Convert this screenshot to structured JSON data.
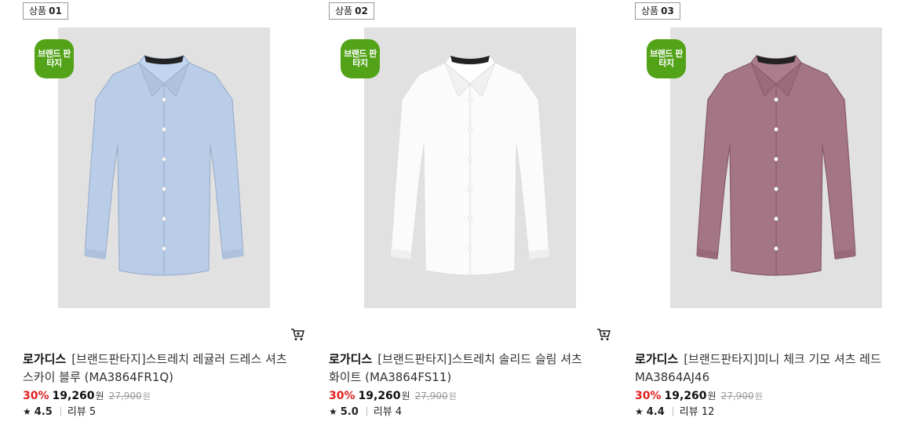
{
  "products": [
    {
      "tag_prefix": "상품",
      "tag_number": "01",
      "badge": "브랜드 판타지",
      "brand": "로가디스",
      "name": "[브랜드판타지]스트레치 레귤러 드레스 셔츠 스카이 블루 (MA3864FR1Q)",
      "discount": "30%",
      "price": "19,260",
      "currency": "원",
      "original_price": "27,900",
      "original_currency": "원",
      "star_icon": "star-icon",
      "rating": "4.5",
      "review_label": "리뷰 5",
      "shirt_color": "#b9cde9",
      "image_icon": "dress-shirt-image",
      "cart_icon": "cart-icon"
    },
    {
      "tag_prefix": "상품",
      "tag_number": "02",
      "badge": "브랜드 판타지",
      "brand": "로가디스",
      "name": "[브랜드판타지]스트레치 솔리드 슬림 셔츠 화이트 (MA3864FS11)",
      "discount": "30%",
      "price": "19,260",
      "currency": "원",
      "original_price": "27,900",
      "original_currency": "원",
      "star_icon": "star-icon",
      "rating": "5.0",
      "review_label": "리뷰 4",
      "shirt_color": "#fbfbfb",
      "image_icon": "dress-shirt-image",
      "cart_icon": "cart-icon"
    },
    {
      "tag_prefix": "상품",
      "tag_number": "03",
      "badge": "브랜드 판타지",
      "brand": "로가디스",
      "name": "[브랜드판타지]미니 체크 기모 셔츠 레드 MA3864AJ46",
      "discount": "30%",
      "price": "19,260",
      "currency": "원",
      "original_price": "27,900",
      "original_currency": "원",
      "star_icon": "star-icon",
      "rating": "4.4",
      "review_label": "리뷰 12",
      "shirt_color": "#a37585",
      "image_icon": "dress-shirt-image",
      "cart_icon": "cart-icon"
    }
  ]
}
